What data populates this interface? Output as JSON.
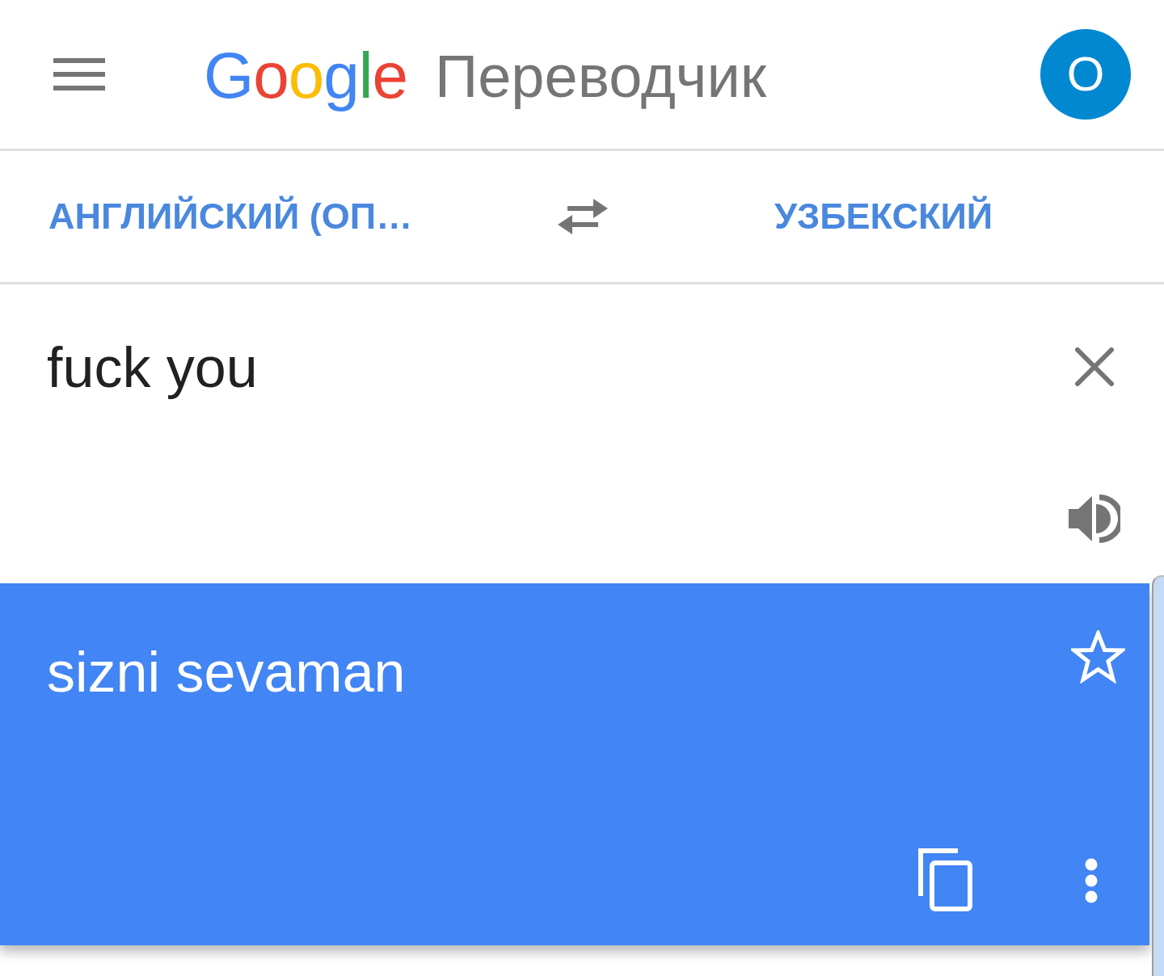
{
  "header": {
    "logo": "Google",
    "title": "Переводчик",
    "avatar": "O"
  },
  "languages": {
    "source": "АНГЛИЙСКИЙ (ОП…",
    "target": "УЗБЕКСКИЙ"
  },
  "input": {
    "value": "fuck you"
  },
  "result": {
    "text": "sizni sevaman",
    "starred": false
  }
}
